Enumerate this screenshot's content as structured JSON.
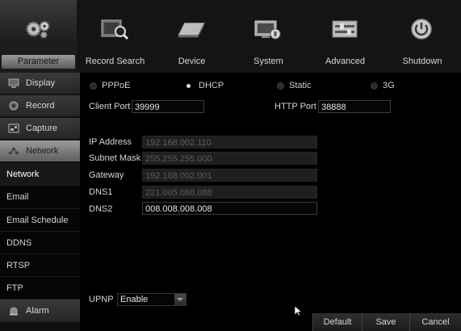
{
  "topbar": {
    "items": [
      {
        "label": "Parameter",
        "icon": "gears-icon"
      },
      {
        "label": "Record Search",
        "icon": "record-search-icon"
      },
      {
        "label": "Device",
        "icon": "device-icon"
      },
      {
        "label": "System",
        "icon": "system-icon"
      },
      {
        "label": "Advanced",
        "icon": "advanced-icon"
      },
      {
        "label": "Shutdown",
        "icon": "power-icon"
      }
    ],
    "active": "Parameter"
  },
  "sidebar": {
    "main_items": [
      {
        "label": "Display",
        "icon": "display-icon"
      },
      {
        "label": "Record",
        "icon": "record-icon"
      },
      {
        "label": "Capture",
        "icon": "capture-icon"
      },
      {
        "label": "Network",
        "icon": "network-icon"
      }
    ],
    "sub_items": [
      "Network",
      "Email",
      "Email Schedule",
      "DDNS",
      "RTSP",
      "FTP"
    ],
    "alarm": {
      "label": "Alarm",
      "icon": "alarm-icon"
    }
  },
  "network": {
    "modes": [
      "PPPoE",
      "DHCP",
      "Static",
      "3G"
    ],
    "selected_mode": "DHCP",
    "client_port_label": "Client Port",
    "client_port": "39999",
    "http_port_label": "HTTP Port",
    "http_port": "38888",
    "ip_label": "IP Address",
    "ip": "192.168.002.110",
    "subnet_label": "Subnet Mask",
    "subnet": "255.255.255.000",
    "gateway_label": "Gateway",
    "gateway": "192.168.002.001",
    "dns1_label": "DNS1",
    "dns1": "221.005.088.088",
    "dns2_label": "DNS2",
    "dns2": "008.008.008.008",
    "upnp_label": "UPNP",
    "upnp_value": "Enable"
  },
  "buttons": {
    "default": "Default",
    "save": "Save",
    "cancel": "Cancel"
  }
}
